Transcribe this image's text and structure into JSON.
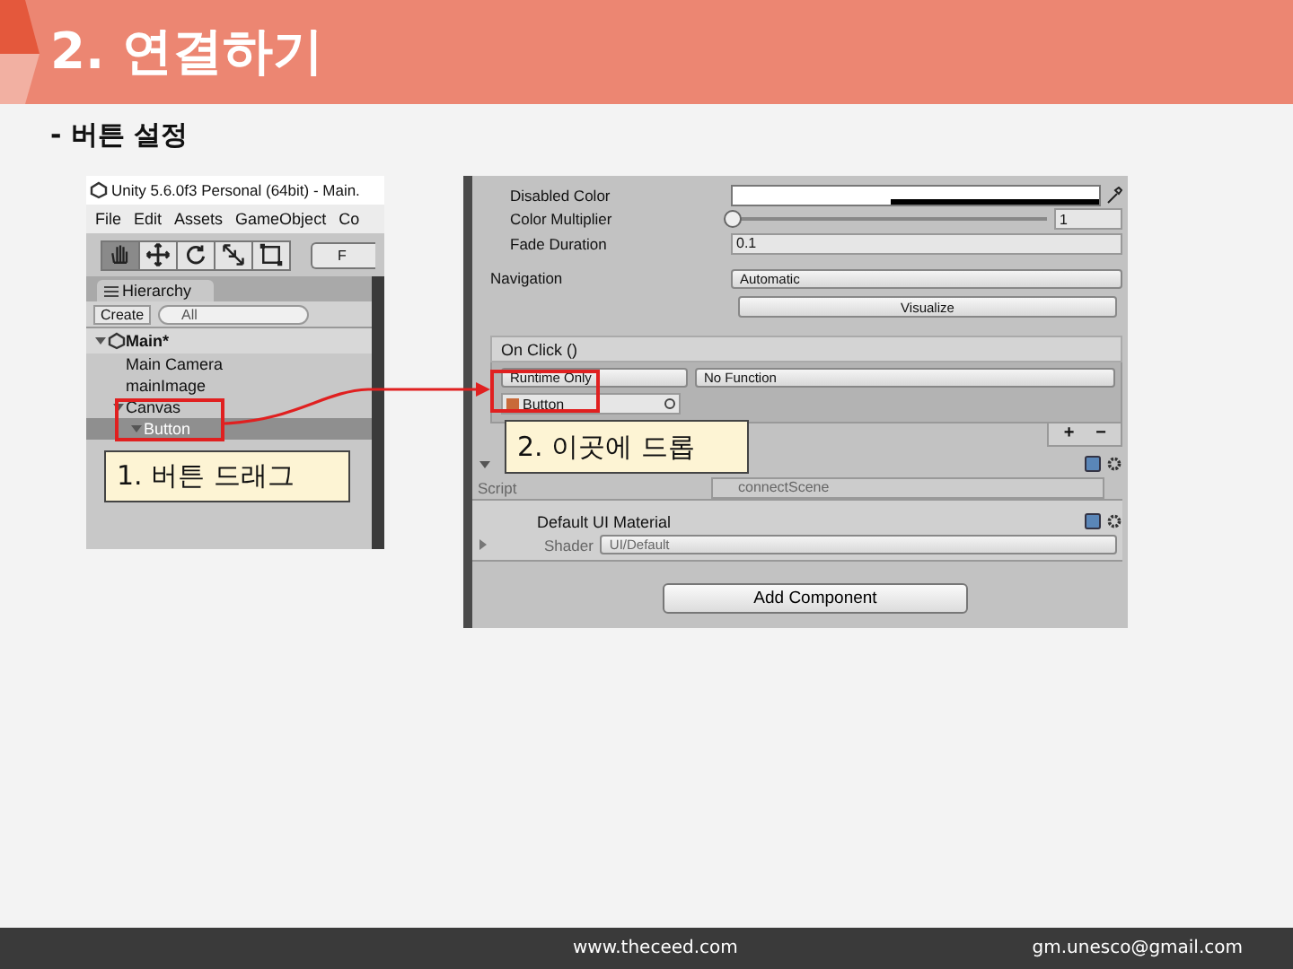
{
  "slide": {
    "title": "2. 연결하기",
    "subtitle": "- 버튼 설정"
  },
  "hierarchy_window": {
    "title": "Unity 5.6.0f3 Personal (64bit) - Main.",
    "menu": [
      "File",
      "Edit",
      "Assets",
      "GameObject",
      "Co"
    ],
    "tools": [
      {
        "kind": "hand",
        "selected": true
      },
      {
        "kind": "move",
        "selected": false
      },
      {
        "kind": "rotate",
        "selected": false
      },
      {
        "kind": "scale",
        "selected": false
      },
      {
        "kind": "rect",
        "selected": false
      }
    ],
    "pivot_button": "F",
    "tab": "Hierarchy",
    "create": "Create",
    "search": "All",
    "tree": [
      {
        "label": "Main*",
        "selected": false,
        "expanded": true,
        "children": [
          {
            "label": "Main Camera",
            "selected": false
          },
          {
            "label": "mainImage",
            "selected": false
          },
          {
            "label": "Canvas",
            "selected": false,
            "expanded": true,
            "children": [
              {
                "label": "Button",
                "selected": true,
                "expanded": true
              }
            ]
          }
        ]
      }
    ]
  },
  "inspector": {
    "properties": [
      {
        "kind": "color",
        "label": "Disabled Color"
      },
      {
        "kind": "slider",
        "label": "Color Multiplier",
        "level": 0,
        "value": "1"
      },
      {
        "kind": "text",
        "label": "Fade Duration",
        "value": "0.1"
      },
      {
        "kind": "dropdown",
        "label": "Navigation",
        "value": "Automatic"
      }
    ],
    "visualize_button": "Visualize",
    "on_click": {
      "title": "On Click ()",
      "call_state": "Runtime Only",
      "function": "No Function",
      "target": "Button",
      "add": "+",
      "remove": "−"
    },
    "script_row": {
      "label": "Script",
      "value": "connectScene"
    },
    "material": {
      "name": "Default UI Material",
      "shader_label": "Shader",
      "shader": "UI/Default"
    },
    "add_component": "Add Component"
  },
  "callouts": [
    "1. 버튼 드래그",
    "2. 이곳에 드롭"
  ],
  "footer": {
    "website": "www.theceed.com",
    "email": "gm.unesco@gmail.com"
  }
}
